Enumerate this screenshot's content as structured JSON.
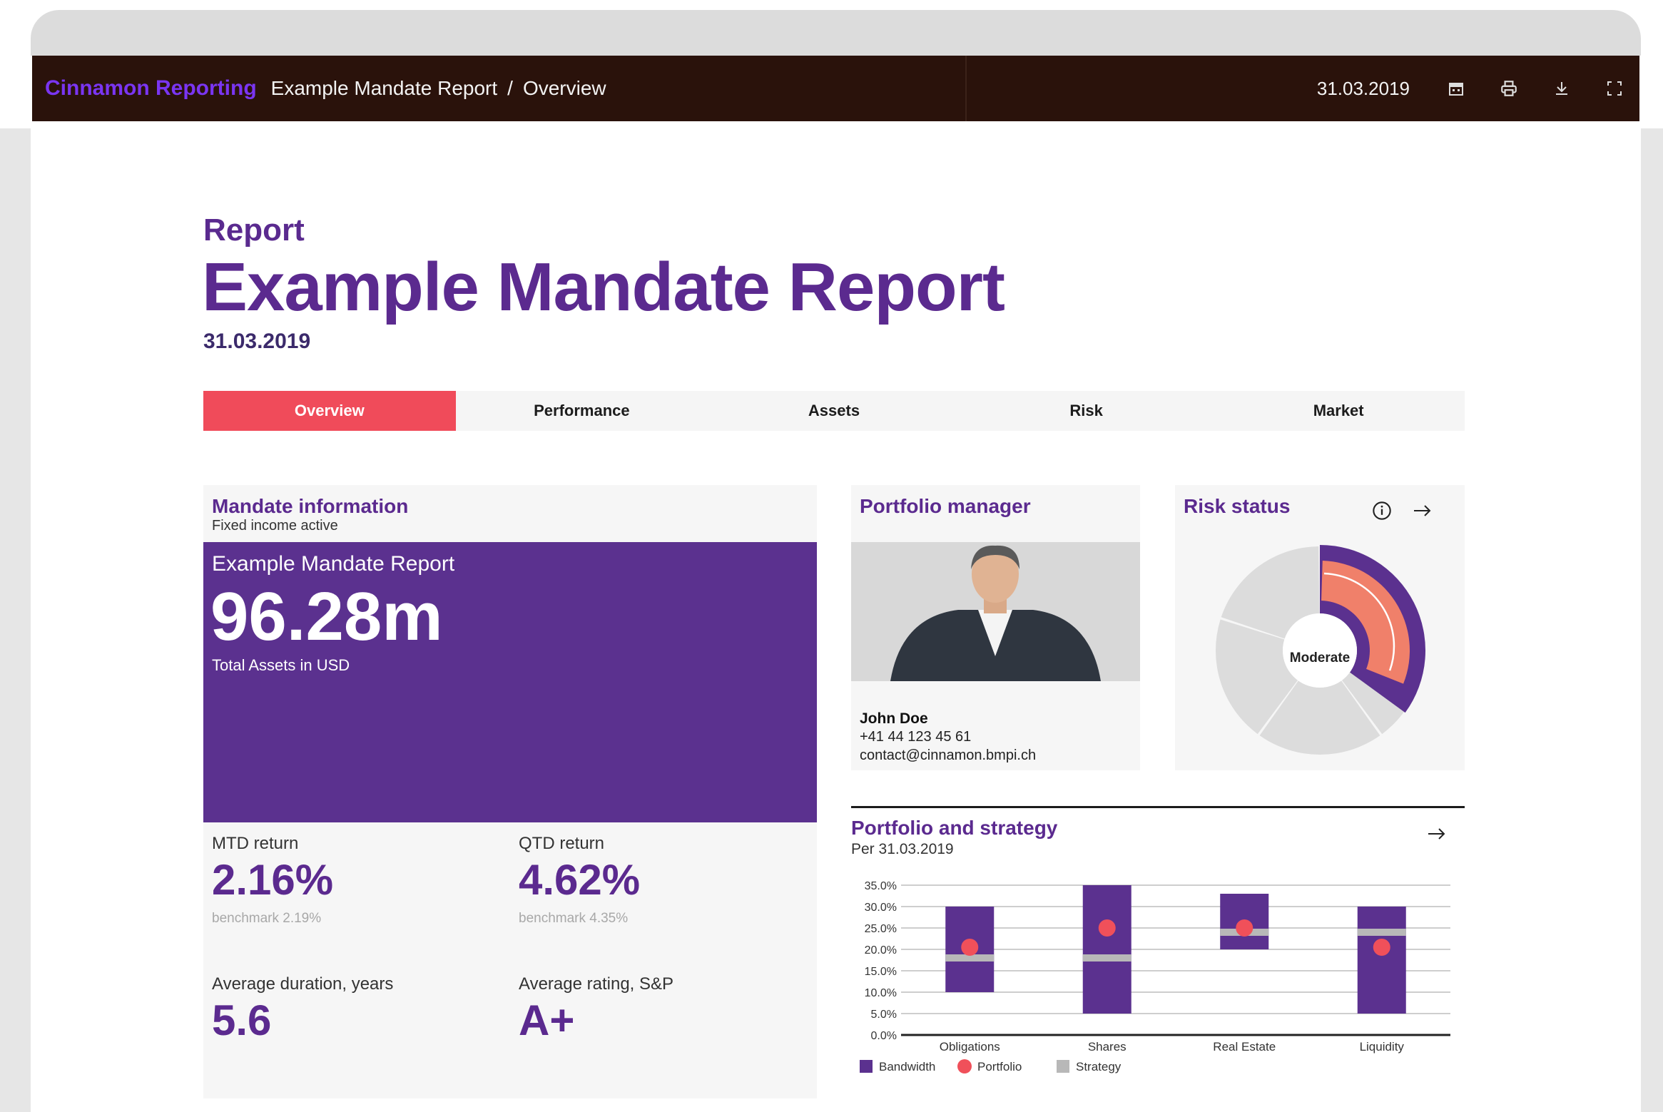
{
  "topbar": {
    "brand": "Cinnamon Reporting",
    "breadcrumb": [
      "Example Mandate Report",
      "/",
      "Overview"
    ],
    "date": "31.03.2019",
    "icons": [
      "calendar-icon",
      "print-icon",
      "download-icon",
      "fullscreen-icon"
    ]
  },
  "header": {
    "kicker": "Report",
    "title": "Example Mandate Report",
    "date": "31.03.2019"
  },
  "tabs": [
    {
      "label": "Overview",
      "active": true
    },
    {
      "label": "Performance",
      "active": false
    },
    {
      "label": "Assets",
      "active": false
    },
    {
      "label": "Risk",
      "active": false
    },
    {
      "label": "Market",
      "active": false
    }
  ],
  "mandate": {
    "title": "Mandate information",
    "subtitle": "Fixed income active",
    "name": "Example Mandate Report",
    "total_assets": "96.28m",
    "total_assets_label": "Total Assets in USD",
    "metrics": [
      {
        "label": "MTD return",
        "value": "2.16%",
        "benchmark": "benchmark 2.19%"
      },
      {
        "label": "QTD return",
        "value": "4.62%",
        "benchmark": "benchmark 4.35%"
      },
      {
        "label": "Average duration, years",
        "value": "5.6",
        "benchmark": ""
      },
      {
        "label": "Average rating, S&P",
        "value": "A+",
        "benchmark": ""
      }
    ]
  },
  "portfolio_manager": {
    "title": "Portfolio manager",
    "name": "John Doe",
    "phone": "+41 44 123 45 61",
    "email": "contact@cinnamon.bmpi.ch"
  },
  "risk_status": {
    "title": "Risk status",
    "level": "Moderate",
    "colors": {
      "track": "#dcdcdc",
      "band": "#5b318f",
      "level": "#f0806a"
    }
  },
  "portfolio_strategy": {
    "title": "Portfolio and strategy",
    "subtitle": "Per 31.03.2019"
  },
  "chart_data": {
    "type": "bar",
    "categories": [
      "Obligations",
      "Shares",
      "Real Estate",
      "Liquidity"
    ],
    "ylim": [
      0,
      35
    ],
    "yticks": [
      "0.0%",
      "5.0%",
      "10.0%",
      "15.0%",
      "20.0%",
      "25.0%",
      "30.0%",
      "35.0%"
    ],
    "bandwidth": [
      [
        10,
        30
      ],
      [
        5,
        35
      ],
      [
        20,
        33
      ],
      [
        5,
        30
      ]
    ],
    "portfolio": [
      20.5,
      25,
      25,
      20.5
    ],
    "strategy": [
      18,
      18,
      24,
      24
    ],
    "legend": [
      "Bandwidth",
      "Portfolio",
      "Strategy"
    ],
    "legend_placement": "bottom-left",
    "colors": {
      "bandwidth": "#5b318f",
      "portfolio": "#f0505a",
      "strategy": "#b8b8b8"
    }
  }
}
